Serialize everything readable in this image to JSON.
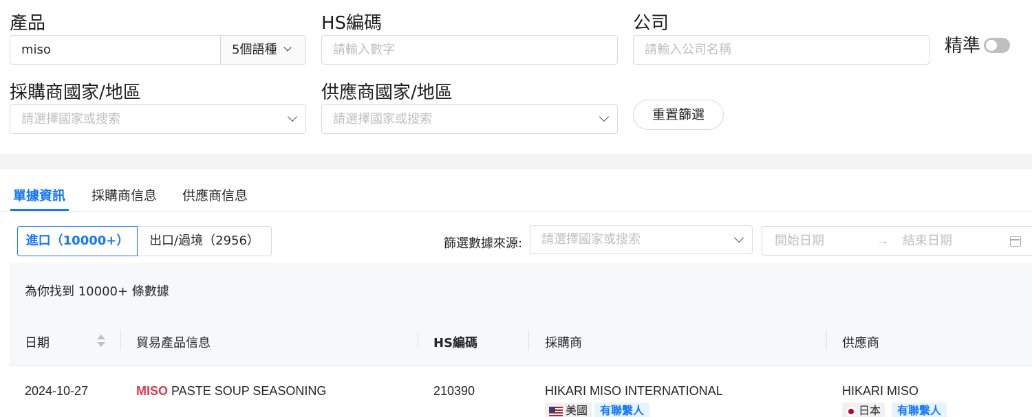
{
  "filters": {
    "product": {
      "label": "產品",
      "value": "miso",
      "lang_select": "5個語種"
    },
    "hs_code": {
      "label": "HS編碼",
      "placeholder": "請輸入數字"
    },
    "company": {
      "label": "公司",
      "placeholder": "請輸入公司名稱"
    },
    "exact": {
      "label": "精準",
      "enabled": false
    },
    "buyer_country": {
      "label": "採購商國家/地區",
      "placeholder": "請選擇國家或搜索"
    },
    "supplier_country": {
      "label": "供應商國家/地區",
      "placeholder": "請選擇國家或搜索"
    },
    "reset_label": "重置篩選"
  },
  "tabs": [
    {
      "label": "單據資訊",
      "active": true
    },
    {
      "label": "採購商信息",
      "active": false
    },
    {
      "label": "供應商信息",
      "active": false
    }
  ],
  "trade_type": {
    "import_label": "進口（10000+）",
    "export_label": "出口/過境（2956）"
  },
  "source_filter": {
    "label": "篩選數據來源:",
    "placeholder": "請選擇國家或搜索"
  },
  "date_range": {
    "start_placeholder": "開始日期",
    "end_placeholder": "結束日期",
    "separator": "→"
  },
  "results": {
    "summary": "為你找到 10000+ 條數據"
  },
  "table": {
    "headers": {
      "date": "日期",
      "product": "貿易產品信息",
      "hs": "HS編碼",
      "buyer": "採購商",
      "supplier": "供應商"
    },
    "rows": [
      {
        "date": "2024-10-27",
        "product_keyword": "MISO",
        "product_rest": " PASTE SOUP SEASONING",
        "hs": "210390",
        "buyer": "HIKARI MISO INTERNATIONAL",
        "buyer_country": "美國",
        "buyer_contact": "有聯繫人",
        "supplier": "HIKARI MISO",
        "supplier_country": "日本",
        "supplier_contact": "有聯繫人"
      }
    ]
  },
  "colors": {
    "accent": "#1677ff",
    "keyword": "#e5344a",
    "contact_bg": "#e6f4ff"
  }
}
